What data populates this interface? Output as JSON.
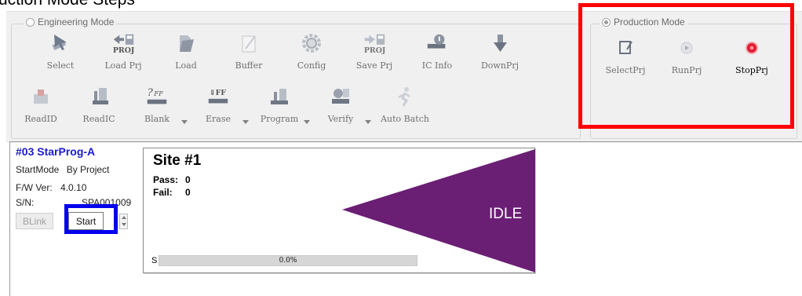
{
  "caption": "uction Mode Steps",
  "engineering_mode": {
    "title": "Engineering Mode",
    "row1": [
      {
        "id": "select",
        "label": "Select",
        "icon": "select-cursor-icon"
      },
      {
        "id": "load-prj",
        "label": "Load Prj",
        "icon": "load-project-icon"
      },
      {
        "id": "load",
        "label": "Load",
        "icon": "folder-open-icon"
      },
      {
        "id": "buffer",
        "label": "Buffer",
        "icon": "buffer-edit-icon"
      },
      {
        "id": "config",
        "label": "Config",
        "icon": "gear-icon"
      },
      {
        "id": "save-prj",
        "label": "Save Prj",
        "icon": "save-project-icon"
      },
      {
        "id": "ic-info",
        "label": "IC Info",
        "icon": "chip-info-icon"
      },
      {
        "id": "downprj",
        "label": "DownPrj",
        "icon": "download-project-icon"
      }
    ],
    "row2": [
      {
        "id": "readid",
        "label": "ReadID",
        "icon": "read-id-icon",
        "dropdown": false
      },
      {
        "id": "readic",
        "label": "ReadIC",
        "icon": "read-ic-icon",
        "dropdown": false
      },
      {
        "id": "blank",
        "label": "Blank",
        "icon": "blank-check-icon",
        "dropdown": true,
        "badge": "?FF"
      },
      {
        "id": "erase",
        "label": "Erase",
        "icon": "erase-icon",
        "dropdown": true,
        "badge": "FF"
      },
      {
        "id": "program",
        "label": "Program",
        "icon": "program-icon",
        "dropdown": true
      },
      {
        "id": "verify",
        "label": "Verify",
        "icon": "verify-icon",
        "dropdown": true
      },
      {
        "id": "auto-batch",
        "label": "Auto Batch",
        "icon": "auto-batch-runner-icon",
        "dropdown": false
      }
    ]
  },
  "production_mode": {
    "title": "Production Mode",
    "selected": true,
    "items": [
      {
        "id": "selectprj",
        "label": "SelectPrj",
        "icon": "select-project-icon"
      },
      {
        "id": "runprj",
        "label": "RunPrj",
        "icon": "run-play-icon"
      },
      {
        "id": "stopprj",
        "label": "StopPrj",
        "icon": "stop-record-icon"
      }
    ]
  },
  "device": {
    "title": "#03 StarProg-A",
    "start_mode_label": "StartMode",
    "start_mode_value": "By Project",
    "fw_label": "F/W Ver:",
    "fw_value": "4.0.10",
    "sn_label": "S/N:",
    "sn_value": "SPA001009",
    "blink_label": "BLink",
    "start_label": "Start"
  },
  "site": {
    "title": "Site #1",
    "pass_label": "Pass:",
    "pass_value": "0",
    "fail_label": "Fail:",
    "fail_value": "0",
    "status": "IDLE",
    "progress_prefix": "S",
    "progress_text": "0.0%",
    "progress_value": 0.0
  },
  "colors": {
    "highlight_red": "#ff0000",
    "highlight_blue": "#0000ee",
    "idle_triangle": "#6a1e74",
    "device_title": "#1a1acd",
    "stop_red": "#e0192e"
  }
}
